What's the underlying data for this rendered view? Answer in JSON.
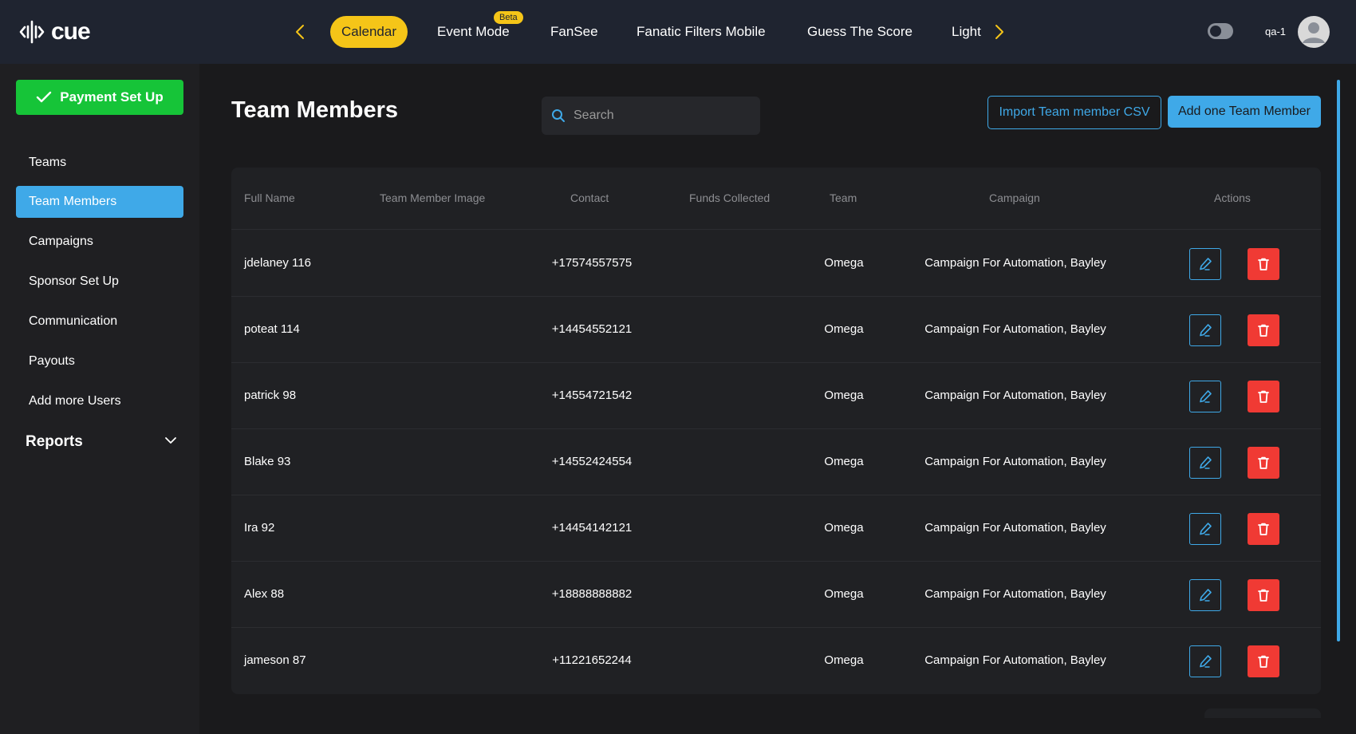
{
  "app": {
    "logo_text": "cue"
  },
  "topnav": {
    "tabs": [
      {
        "label": "Calendar",
        "active": true
      },
      {
        "label": "Event Mode",
        "badge": "Beta"
      },
      {
        "label": "FanSee"
      },
      {
        "label": "Fanatic Filters Mobile"
      },
      {
        "label": "Guess The Score"
      },
      {
        "label": "Light"
      }
    ],
    "user": "qa-1"
  },
  "sidebar": {
    "payment_button": "Payment Set Up",
    "items": [
      {
        "label": "Teams"
      },
      {
        "label": "Team Members",
        "active": true
      },
      {
        "label": "Campaigns"
      },
      {
        "label": "Sponsor Set Up"
      },
      {
        "label": "Communication"
      },
      {
        "label": "Payouts"
      },
      {
        "label": "Add more Users"
      }
    ],
    "reports": "Reports"
  },
  "main": {
    "title": "Team Members",
    "search_placeholder": "Search",
    "import_button": "Import Team member CSV",
    "add_button": "Add one Team Member",
    "columns": [
      "Full Name",
      "Team Member Image",
      "Contact",
      "Funds Collected",
      "Team",
      "Campaign",
      "Actions"
    ],
    "rows": [
      {
        "name": "jdelaney 116",
        "contact": "+17574557575",
        "team": "Omega",
        "campaign": "Campaign For Automation, Bayley"
      },
      {
        "name": "poteat 114",
        "contact": "+14454552121",
        "team": "Omega",
        "campaign": "Campaign For Automation, Bayley"
      },
      {
        "name": "patrick 98",
        "contact": "+14554721542",
        "team": "Omega",
        "campaign": "Campaign For Automation, Bayley"
      },
      {
        "name": "Blake 93",
        "contact": "+14552424554",
        "team": "Omega",
        "campaign": "Campaign For Automation, Bayley"
      },
      {
        "name": "Ira 92",
        "contact": "+14454142121",
        "team": "Omega",
        "campaign": "Campaign For Automation, Bayley"
      },
      {
        "name": "Alex 88",
        "contact": "+18888888882",
        "team": "Omega",
        "campaign": "Campaign For Automation, Bayley"
      },
      {
        "name": "jameson 87",
        "contact": "+11221652244",
        "team": "Omega",
        "campaign": "Campaign For Automation, Bayley"
      }
    ]
  },
  "colors": {
    "accent": "#f5c518",
    "primary": "#3fa9e8",
    "success": "#16c438",
    "danger": "#f03a34"
  },
  "icons": [
    "logo-wave-icon",
    "chevron-left-icon",
    "chevron-right-icon",
    "theme-toggle-icon",
    "user-avatar-icon",
    "check-icon",
    "chevron-down-icon",
    "search-icon",
    "edit-pencil-icon",
    "trash-icon"
  ]
}
